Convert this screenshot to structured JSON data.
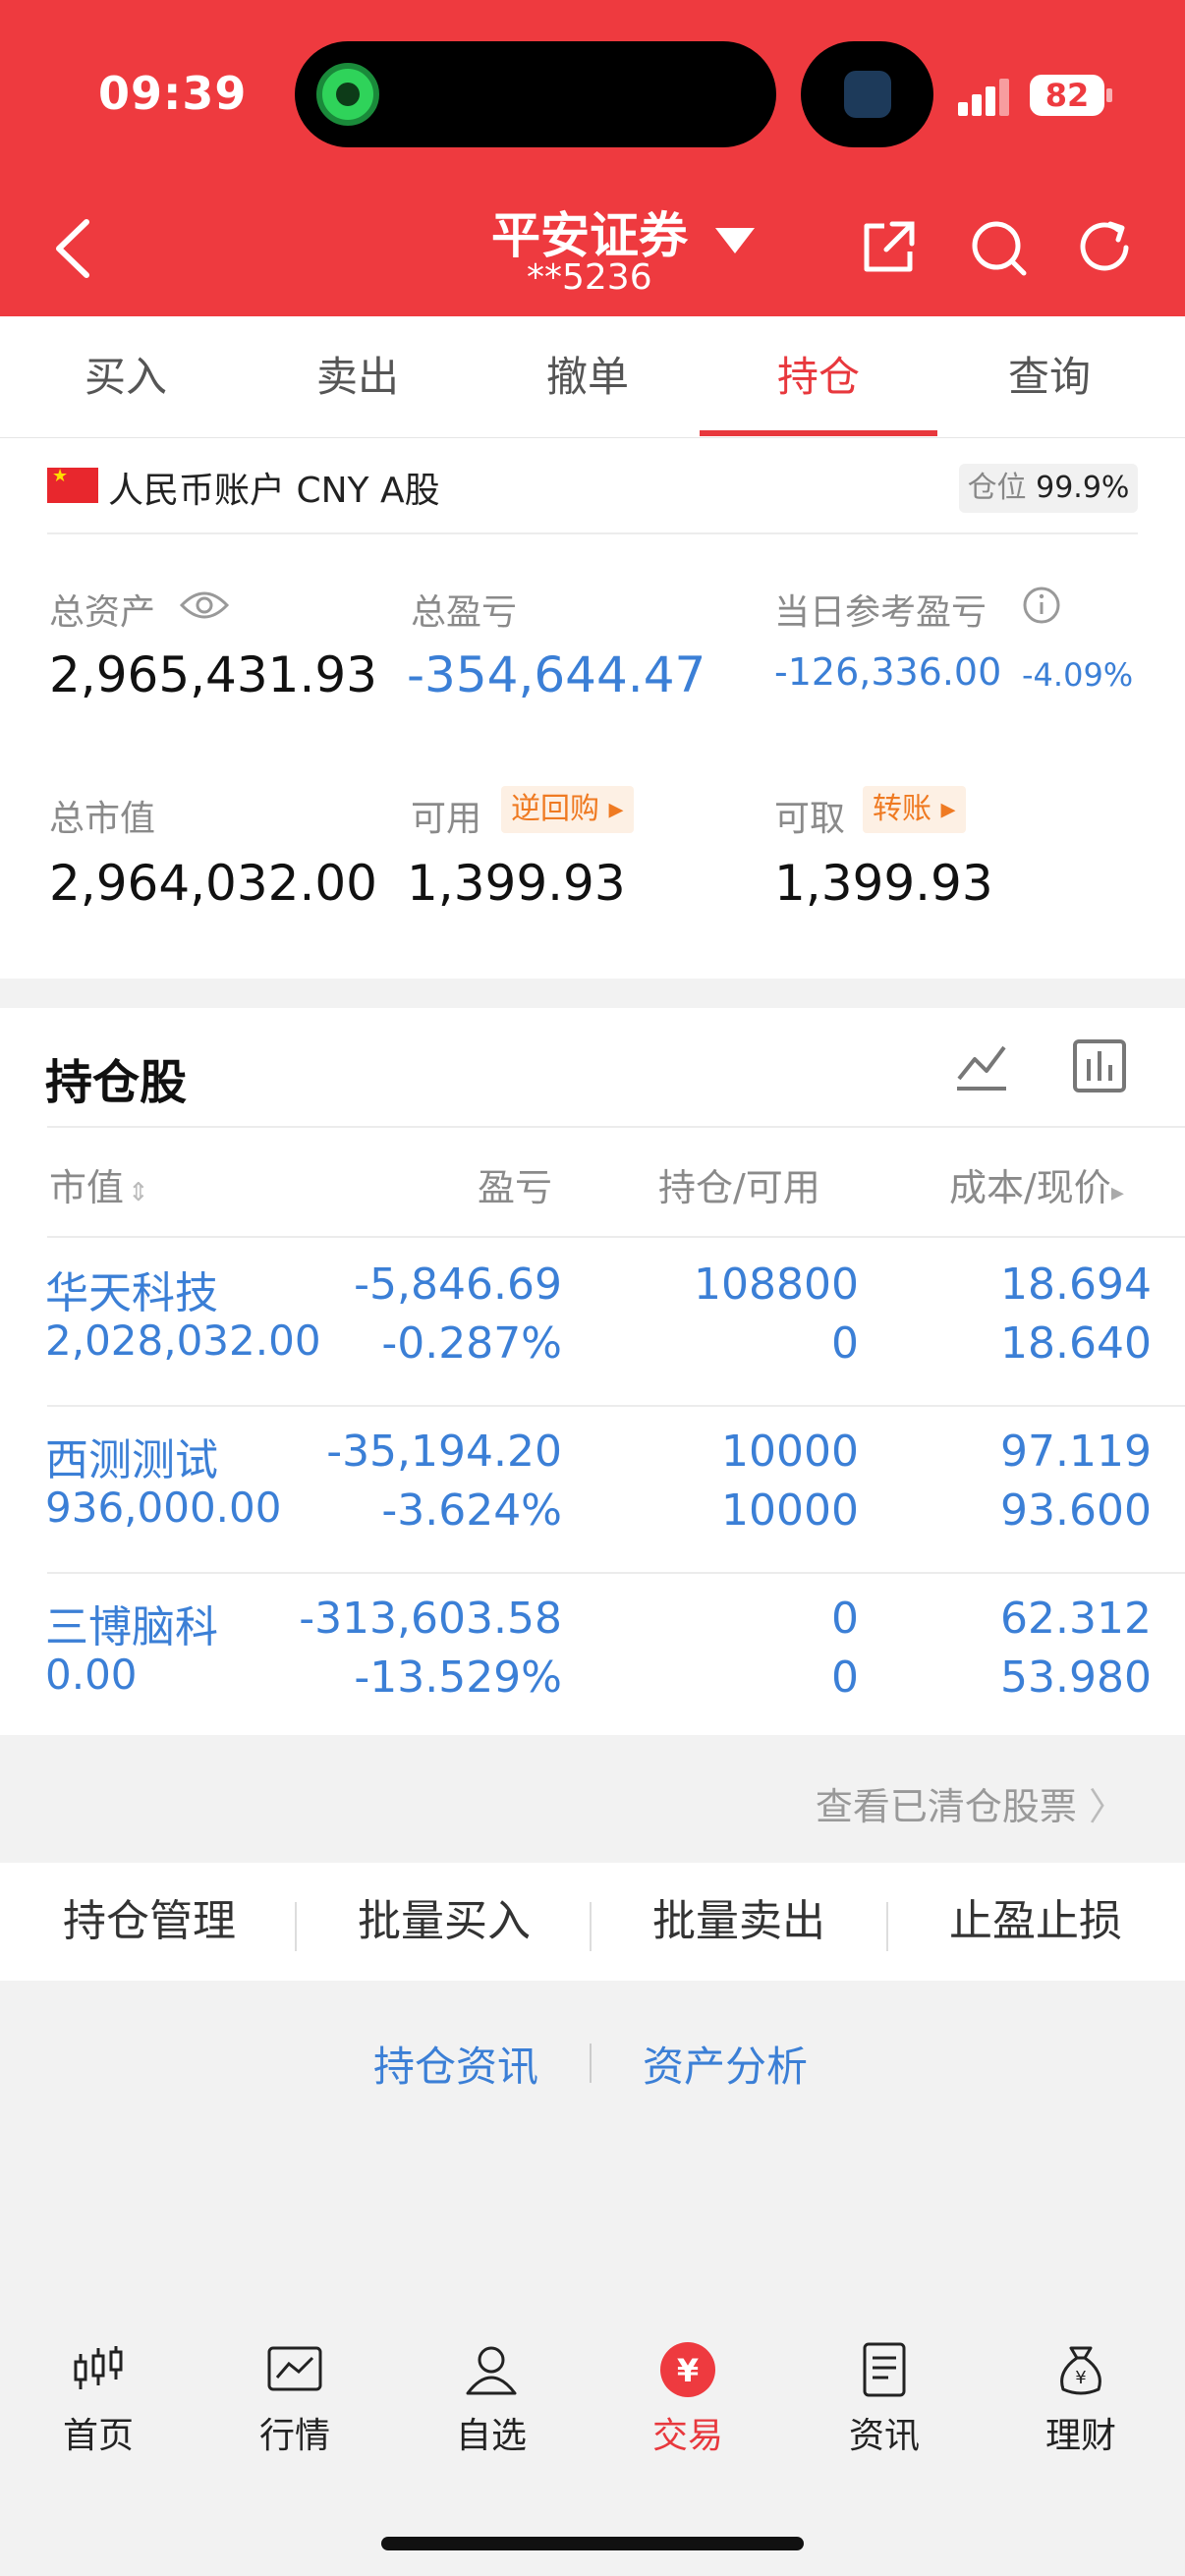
{
  "status_bar": {
    "time": "09:39",
    "battery": "82"
  },
  "header": {
    "title": "平安证券",
    "account": "**5236"
  },
  "tabs": [
    {
      "label": "买入"
    },
    {
      "label": "卖出"
    },
    {
      "label": "撤单"
    },
    {
      "label": "持仓",
      "active": true
    },
    {
      "label": "查询"
    }
  ],
  "account": {
    "label": "人民币账户 CNY A股",
    "position_label": "仓位",
    "position_value": "99.9%",
    "total_assets_label": "总资产",
    "total_assets": "2,965,431.93",
    "total_pnl_label": "总盈亏",
    "total_pnl": "-354,644.47",
    "daily_pnl_label": "当日参考盈亏",
    "daily_pnl": "-126,336.00",
    "daily_pnl_pct": "-4.09%",
    "market_value_label": "总市值",
    "market_value": "2,964,032.00",
    "available_label": "可用",
    "available": "1,399.93",
    "reverse_repo_tag": "逆回购",
    "withdrawable_label": "可取",
    "withdrawable": "1,399.93",
    "transfer_tag": "转账"
  },
  "holdings": {
    "title": "持仓股",
    "columns": [
      "市值",
      "盈亏",
      "持仓/可用",
      "成本/现价"
    ],
    "rows": [
      {
        "name": "华天科技",
        "market_value": "2,028,032.00",
        "pnl": "-5,846.69",
        "pnl_pct": "-0.287%",
        "position": "108800",
        "available": "0",
        "cost": "18.694",
        "price": "18.640"
      },
      {
        "name": "西测测试",
        "market_value": "936,000.00",
        "pnl": "-35,194.20",
        "pnl_pct": "-3.624%",
        "position": "10000",
        "available": "10000",
        "cost": "97.119",
        "price": "93.600"
      },
      {
        "name": "三博脑科",
        "market_value": "0.00",
        "pnl": "-313,603.58",
        "pnl_pct": "-13.529%",
        "position": "0",
        "available": "0",
        "cost": "62.312",
        "price": "53.980"
      }
    ],
    "cleared_link": "查看已清仓股票"
  },
  "actions": [
    "持仓管理",
    "批量买入",
    "批量卖出",
    "止盈止损"
  ],
  "links": [
    "持仓资讯",
    "资产分析"
  ],
  "bottom_nav": [
    {
      "label": "首页",
      "icon": "candlestick-icon"
    },
    {
      "label": "行情",
      "icon": "chart-icon"
    },
    {
      "label": "自选",
      "icon": "person-icon"
    },
    {
      "label": "交易",
      "icon": "yuan-icon",
      "active": true
    },
    {
      "label": "资讯",
      "icon": "news-icon"
    },
    {
      "label": "理财",
      "icon": "moneybag-icon"
    }
  ],
  "colors": {
    "brand": "#ee3a3f",
    "loss_blue": "#3b7fd6",
    "tag_orange": "#ef7a22"
  }
}
